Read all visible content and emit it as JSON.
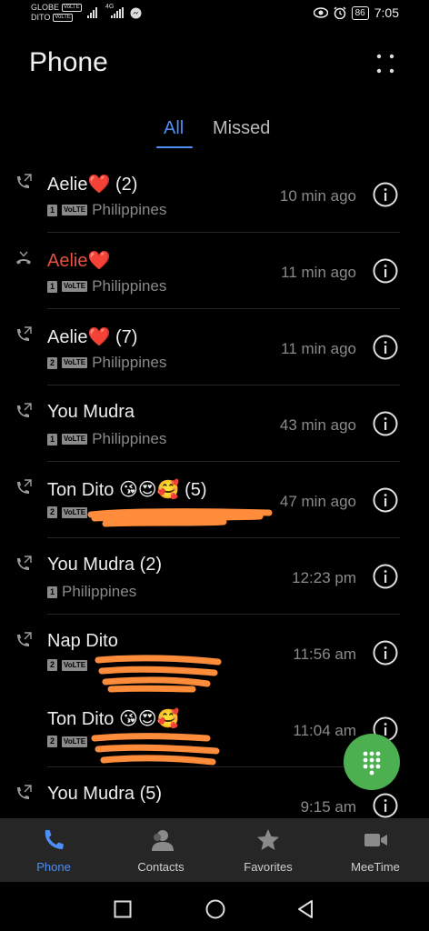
{
  "status_bar": {
    "carrier1": "GLOBE",
    "carrier2": "DITO",
    "volte": "VoLTE",
    "network": "4G",
    "battery": "86",
    "time": "7:05"
  },
  "header": {
    "title": "Phone"
  },
  "tabs": [
    {
      "label": "All",
      "active": true
    },
    {
      "label": "Missed",
      "active": false
    }
  ],
  "calls": [
    {
      "name": "Aelie",
      "emoji": "❤️",
      "count": "(2)",
      "sim": "1",
      "volte": "VoLTE",
      "detail": "Philippines",
      "time": "10 min ago",
      "type": "outgoing",
      "missed": false
    },
    {
      "name": "Aelie",
      "emoji": "❤️",
      "count": "",
      "sim": "1",
      "volte": "VoLTE",
      "detail": "Philippines",
      "time": "11 min ago",
      "type": "missed",
      "missed": true
    },
    {
      "name": "Aelie",
      "emoji": "❤️",
      "count": "(7)",
      "sim": "2",
      "volte": "VoLTE",
      "detail": "Philippines",
      "time": "11 min ago",
      "type": "outgoing",
      "missed": false
    },
    {
      "name": "You Mudra",
      "emoji": "",
      "count": "",
      "sim": "1",
      "volte": "VoLTE",
      "detail": "Philippines",
      "time": "43 min ago",
      "type": "outgoing",
      "missed": false
    },
    {
      "name": "Ton Dito",
      "emoji": "😘😍🥰",
      "count": "(5)",
      "sim": "2",
      "volte": "VoLTE",
      "detail": "",
      "time": "47 min ago",
      "type": "outgoing",
      "missed": false
    },
    {
      "name": "You Mudra",
      "emoji": "",
      "count": "(2)",
      "sim": "1",
      "volte": "",
      "detail": "Philippines",
      "time": "12:23 pm",
      "type": "outgoing",
      "missed": false
    },
    {
      "name": "Nap Dito",
      "emoji": "",
      "count": "",
      "sim": "2",
      "volte": "VoLTE",
      "detail": "",
      "time": "11:56 am",
      "type": "outgoing",
      "missed": false
    },
    {
      "name": "Ton Dito",
      "emoji": "😘😍🥰",
      "count": "",
      "sim": "2",
      "volte": "VoLTE",
      "detail": "",
      "time": "11:04 am",
      "type": "incoming",
      "missed": false
    },
    {
      "name": "You Mudra",
      "emoji": "",
      "count": "(5)",
      "sim": "",
      "volte": "",
      "detail": "",
      "time": "9:15 am",
      "type": "outgoing",
      "missed": false
    }
  ],
  "bottom_nav": [
    {
      "label": "Phone",
      "icon": "phone-icon",
      "active": true
    },
    {
      "label": "Contacts",
      "icon": "contacts-icon",
      "active": false
    },
    {
      "label": "Favorites",
      "icon": "star-icon",
      "active": false
    },
    {
      "label": "MeeTime",
      "icon": "video-icon",
      "active": false
    }
  ],
  "colors": {
    "accent": "#4d8ef7",
    "missed": "#e8503f",
    "fab": "#4caf50",
    "redaction": "#ff8c3a"
  }
}
